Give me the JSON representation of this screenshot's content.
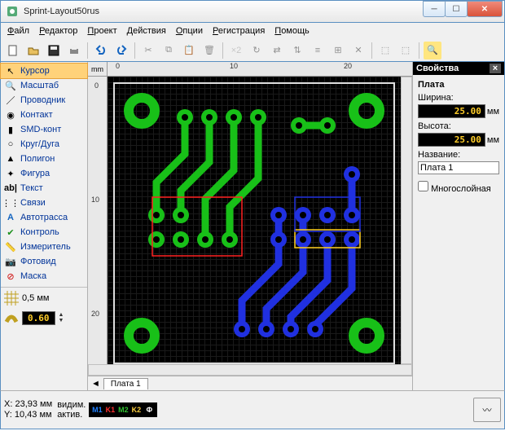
{
  "window": {
    "title": "Sprint-Layout50rus"
  },
  "menu": [
    "Файл",
    "Редактор",
    "Проект",
    "Действия",
    "Опции",
    "Регистрация",
    "Помощь"
  ],
  "tools": [
    {
      "icon": "cursor",
      "label": "Курсор",
      "sel": true
    },
    {
      "icon": "zoom",
      "label": "Масштаб"
    },
    {
      "icon": "track",
      "label": "Проводник"
    },
    {
      "icon": "pad",
      "label": "Контакт"
    },
    {
      "icon": "smd",
      "label": "SMD-конт"
    },
    {
      "icon": "circle",
      "label": "Круг/Дуга"
    },
    {
      "icon": "poly",
      "label": "Полигон"
    },
    {
      "icon": "shape",
      "label": "Фигура"
    },
    {
      "icon": "text",
      "label": "Текст"
    },
    {
      "icon": "conn",
      "label": "Связи"
    },
    {
      "icon": "auto",
      "label": "Автотрасса"
    },
    {
      "icon": "check",
      "label": "Контроль"
    },
    {
      "icon": "meas",
      "label": "Измеритель"
    },
    {
      "icon": "photo",
      "label": "Фотовид"
    },
    {
      "icon": "mask",
      "label": "Маска"
    }
  ],
  "grid": {
    "label": "0,5 мм"
  },
  "trackwidth": {
    "value": "0.60"
  },
  "ruler": {
    "unit": "mm",
    "hticks": [
      "0",
      "10",
      "20"
    ],
    "vticks": [
      "0",
      "10",
      "20"
    ]
  },
  "properties": {
    "title": "Свойства",
    "section": "Плата",
    "width_label": "Ширина:",
    "width_value": "25.00",
    "height_label": "Высота:",
    "height_value": "25.00",
    "unit": "мм",
    "name_label": "Название:",
    "name_value": "Плата 1",
    "multilayer": "Многослойная"
  },
  "tabs": {
    "board": "Плата 1"
  },
  "status": {
    "x_label": "X:",
    "x_value": "23,93 мм",
    "y_label": "Y:",
    "y_value": "10,43 мм",
    "visible": "видим.",
    "active": "актив.",
    "layers": [
      {
        "t": "M1",
        "c": "#2080ff"
      },
      {
        "t": "K1",
        "c": "#ff3030"
      },
      {
        "t": "M2",
        "c": "#30c030"
      },
      {
        "t": "K2",
        "c": "#ffd040"
      },
      {
        "t": "Ф",
        "c": "#ffffff"
      }
    ]
  },
  "colors": {
    "top": "#18c018",
    "bottom": "#2030e0",
    "sel1": "#ff2020",
    "sel2": "#ffd020"
  }
}
